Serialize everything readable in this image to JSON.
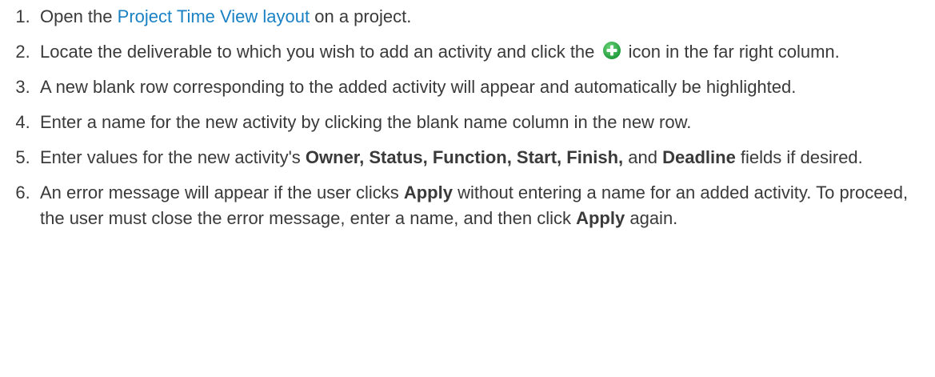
{
  "steps": [
    {
      "number": "1.",
      "pre": "Open the ",
      "link": "Project Time View layout",
      "post": " on a project."
    },
    {
      "number": "2.",
      "pre": "Locate the deliverable to which you wish to add an activity and click the ",
      "icon": "add-circle-icon",
      "post": " icon in the far right column."
    },
    {
      "number": "3.",
      "text": "A new blank row corresponding to the added activity will appear and automatically be highlighted."
    },
    {
      "number": "4.",
      "text": "Enter a name for the new activity by clicking the blank name column in the new row."
    },
    {
      "number": "5.",
      "pre": "Enter values for the new activity's ",
      "bold1": "Owner, Status, Function, Start, Finish,",
      "mid": " and ",
      "bold2": "Deadline",
      "post": " fields if desired."
    },
    {
      "number": "6.",
      "pre": "An error message will appear if the user clicks ",
      "bold1": "Apply",
      "mid": " without entering a name for an added activity. To proceed, the user must close the error message, enter a name, and then click ",
      "bold2": "Apply",
      "post": " again."
    }
  ],
  "colors": {
    "text": "#3a3a3a",
    "link": "#1a82c4",
    "icon_green": "#2db24a"
  }
}
